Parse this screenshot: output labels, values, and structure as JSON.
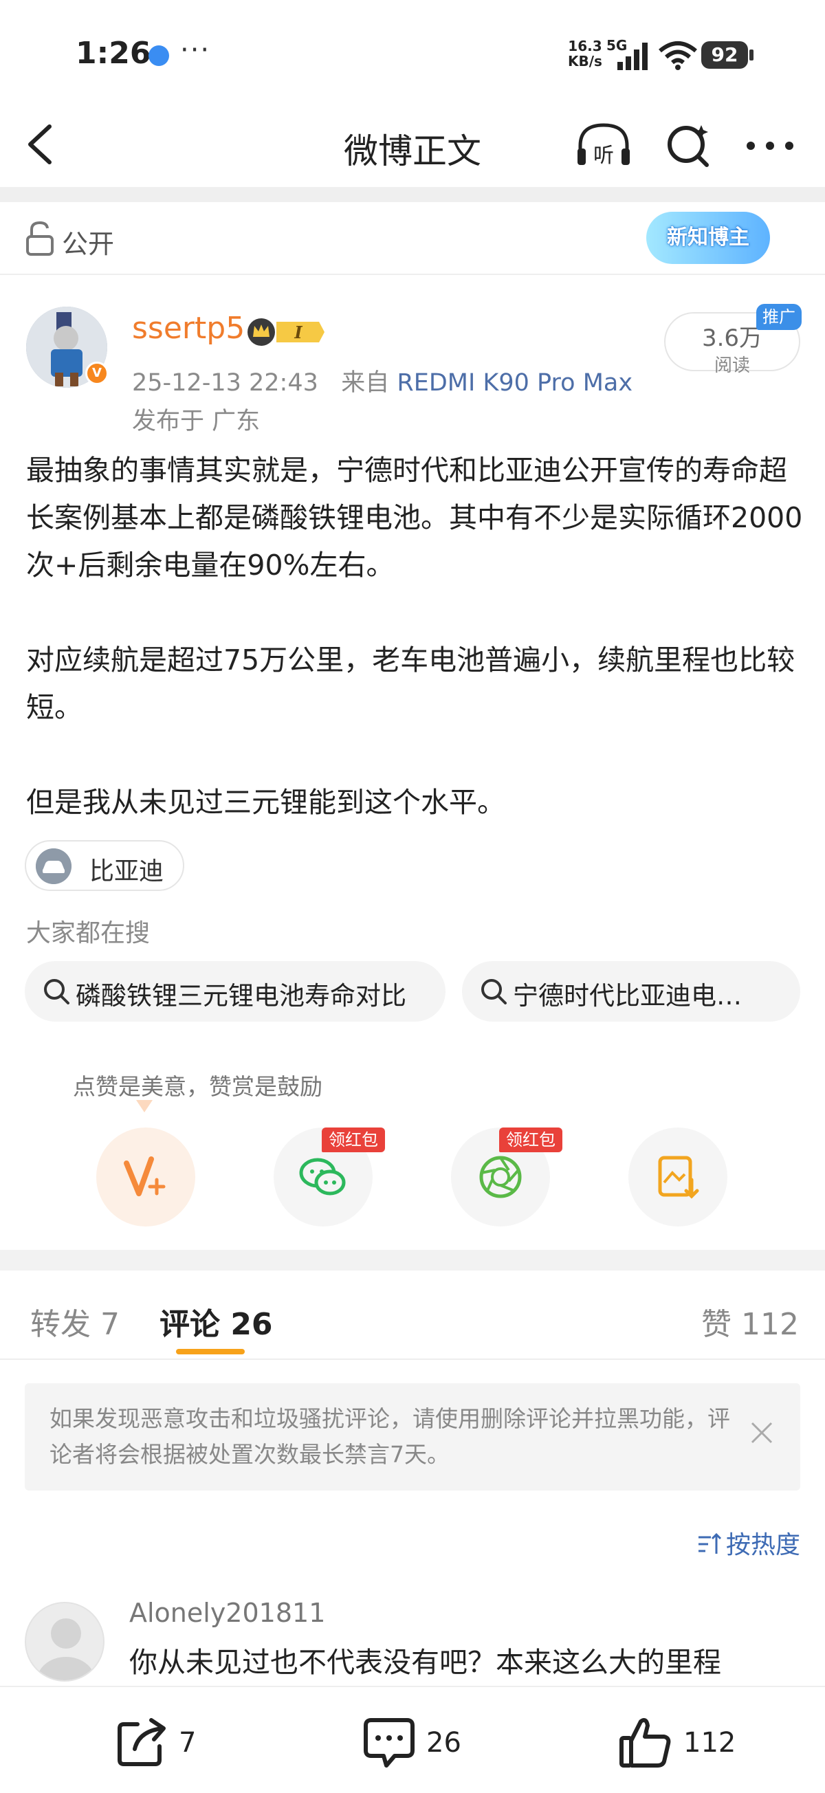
{
  "status_bar": {
    "time": "1:26",
    "net_speed_value": "16.3",
    "net_speed_unit": "KB/s",
    "network": "5G",
    "battery": "92"
  },
  "header": {
    "title": "微博正文",
    "listen_label": "听"
  },
  "visibility": {
    "label": "公开",
    "badge": "新知博主"
  },
  "author": {
    "name": "ssertp5",
    "vip_level": "I",
    "timestamp": "25-12-13 22:43",
    "from_prefix": "来自",
    "source": "REDMI K90 Pro Max",
    "location": "发布于 广东",
    "reads_count": "3.6万",
    "reads_label": "阅读",
    "promo_tag": "推广"
  },
  "post": {
    "paragraphs": [
      "最抽象的事情其实就是，宁德时代和比亚迪公开宣传的寿命超长案例基本上都是磷酸铁锂电池。其中有不少是实际循环2000次+后剩余电量在90%左右。",
      "对应续航是超过75万公里，老车电池普遍小，续航里程也比较短。",
      "但是我从未见过三元锂能到这个水平。"
    ],
    "topic": "比亚迪"
  },
  "searches": {
    "heading": "大家都在搜",
    "items": [
      "磷酸铁锂三元锂电池寿命对比",
      "宁德时代比亚迪电…"
    ]
  },
  "reward": {
    "tip": "点赞是美意，赞赏是鼓励",
    "hongbao_label": "领红包"
  },
  "tabs": {
    "repost": "转发 7",
    "comment": "评论 26",
    "likes": "赞 112"
  },
  "notice": {
    "text": "如果发现恶意攻击和垃圾骚扰评论，请使用删除评论并拉黑功能，评论者将会根据被处置次数最长禁言7天。"
  },
  "sort": {
    "label": "按热度"
  },
  "comment": {
    "user": "Alonely201811",
    "text": "你从未见过也不代表没有吧？本来这么大的里程"
  },
  "bottom_bar": {
    "repost_count": "7",
    "comment_count": "26",
    "like_count": "112"
  },
  "colors": {
    "accent_orange": "#f07c2c",
    "link_blue": "#4d6ea8",
    "tab_underline": "#f7a21a",
    "hongbao_red": "#e9413a"
  }
}
